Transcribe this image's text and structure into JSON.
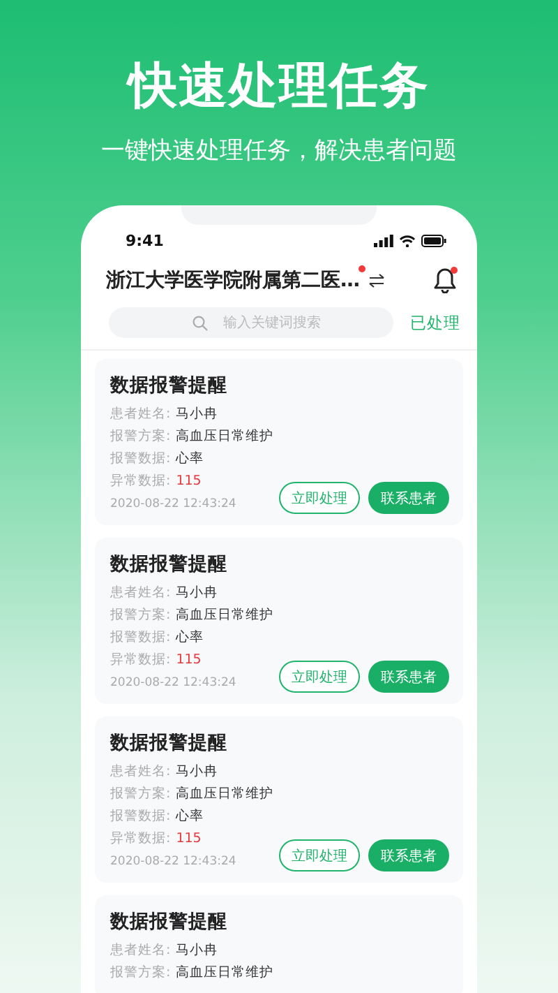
{
  "headline": "快速处理任务",
  "subtitle": "一键快速处理任务，解决患者问题",
  "status_bar": {
    "time": "9:41"
  },
  "header": {
    "title": "浙江大学医学院附属第二医…",
    "title_badge": true,
    "bell_badge": true
  },
  "search": {
    "placeholder": "输入关键词搜索"
  },
  "filter_link": "已处理",
  "cards": [
    {
      "title": "数据报警提醒",
      "fields": [
        {
          "label": "患者姓名:",
          "value": "马小冉",
          "highlight": false
        },
        {
          "label": "报警方案:",
          "value": "高血压日常维护",
          "highlight": false
        },
        {
          "label": "报警数据:",
          "value": "心率",
          "highlight": false
        },
        {
          "label": "异常数据:",
          "value": "115",
          "highlight": true
        }
      ],
      "time": "2020-08-22 12:43:24",
      "buttons": [
        {
          "label": "立即处理",
          "kind": "outline"
        },
        {
          "label": "联系患者",
          "kind": "primary"
        }
      ]
    },
    {
      "title": "数据报警提醒",
      "fields": [
        {
          "label": "患者姓名:",
          "value": "马小冉",
          "highlight": false
        },
        {
          "label": "报警方案:",
          "value": "高血压日常维护",
          "highlight": false
        },
        {
          "label": "报警数据:",
          "value": "心率",
          "highlight": false
        },
        {
          "label": "异常数据:",
          "value": "115",
          "highlight": true
        }
      ],
      "time": "2020-08-22 12:43:24",
      "buttons": [
        {
          "label": "立即处理",
          "kind": "outline"
        },
        {
          "label": "联系患者",
          "kind": "primary"
        }
      ]
    },
    {
      "title": "数据报警提醒",
      "fields": [
        {
          "label": "患者姓名:",
          "value": "马小冉",
          "highlight": false
        },
        {
          "label": "报警方案:",
          "value": "高血压日常维护",
          "highlight": false
        },
        {
          "label": "报警数据:",
          "value": "心率",
          "highlight": false
        },
        {
          "label": "异常数据:",
          "value": "115",
          "highlight": true
        }
      ],
      "time": "2020-08-22 12:43:24",
      "buttons": [
        {
          "label": "立即处理",
          "kind": "outline"
        },
        {
          "label": "联系患者",
          "kind": "primary"
        }
      ]
    },
    {
      "title": "数据报警提醒",
      "fields": [
        {
          "label": "患者姓名:",
          "value": "马小冉",
          "highlight": false
        },
        {
          "label": "报警方案:",
          "value": "高血压日常维护",
          "highlight": false
        }
      ]
    }
  ]
}
